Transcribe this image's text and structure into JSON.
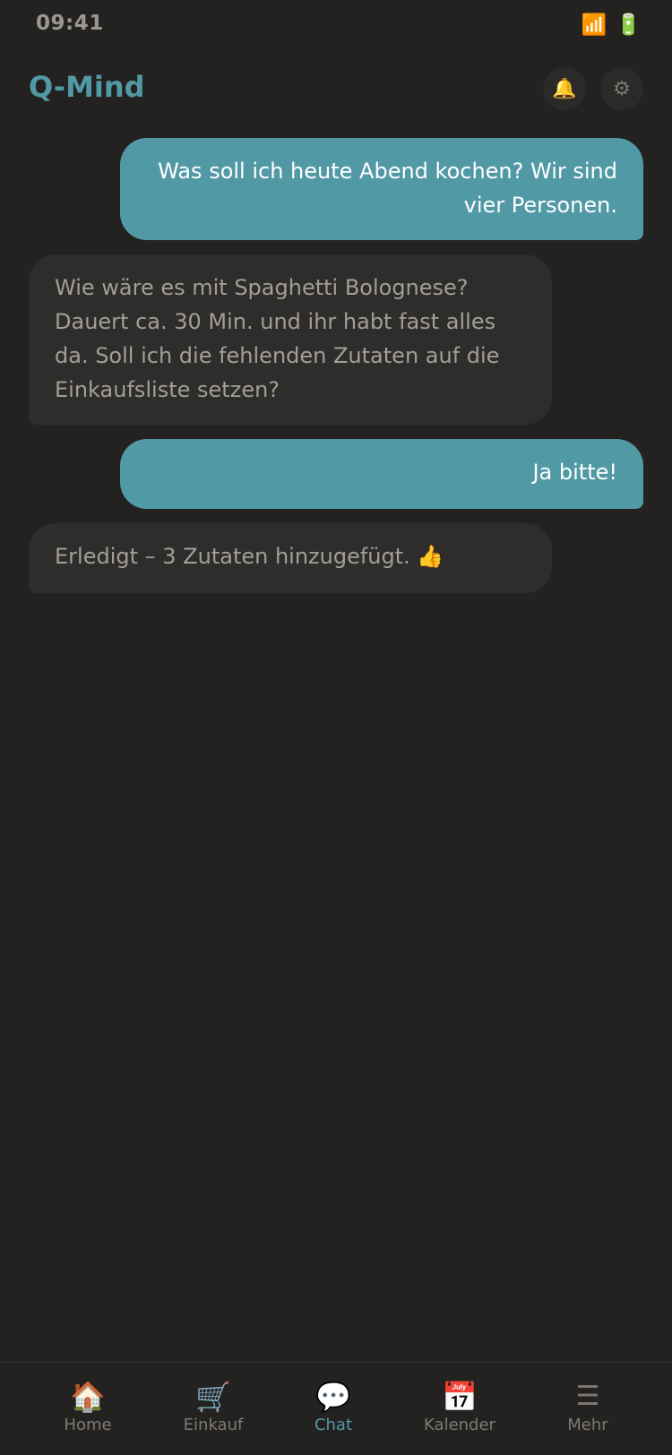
{
  "status_bar": {
    "time": "09:41",
    "signal_icon": "📶",
    "battery_icon": "🔋"
  },
  "header": {
    "title": "Q-Mind",
    "bell_icon": "🔔",
    "gear_icon": "⚙"
  },
  "messages": [
    {
      "role": "user",
      "text": "Was soll ich heute Abend kochen? Wir sind vier Personen."
    },
    {
      "role": "assistant",
      "text": "Wie wäre es mit Spaghetti Bolognese? Dauert ca. 30 Min. und ihr habt fast alles da. Soll ich die fehlenden Zutaten auf die Einkaufsliste setzen?"
    },
    {
      "role": "user",
      "text": "Ja bitte!"
    },
    {
      "role": "assistant",
      "text": "Erledigt – 3 Zutaten hinzugefügt. 👍"
    }
  ],
  "nav": {
    "items": [
      {
        "icon": "🏠",
        "label": "Home"
      },
      {
        "icon": "🛒",
        "label": "Einkauf"
      },
      {
        "icon": "💬",
        "label": "Chat"
      },
      {
        "icon": "📅",
        "label": "Kalender"
      },
      {
        "icon": "☰",
        "label": "Mehr"
      }
    ],
    "active": "Chat"
  },
  "colors": {
    "background": "#242220",
    "accent": "#5299a6",
    "assistant_bubble": "#2f2d2b",
    "muted_text": "#7d7a76"
  }
}
